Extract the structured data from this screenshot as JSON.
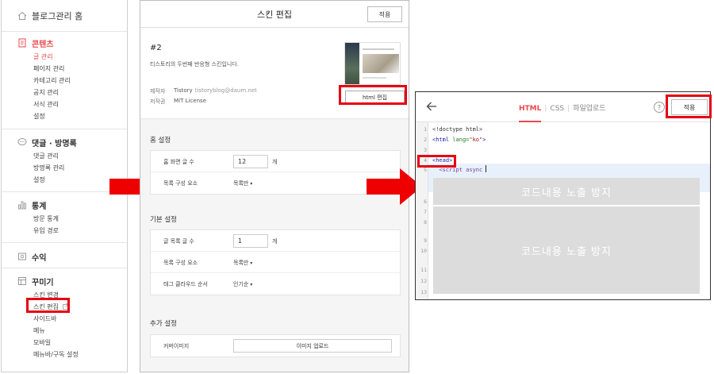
{
  "sidebar": {
    "home": "블로그관리 홈",
    "sections": [
      {
        "title": "콘텐츠",
        "icon": "document-icon",
        "items": [
          "글 관리",
          "페이지 관리",
          "카테고리 관리",
          "공지 관리",
          "서식 관리",
          "설정"
        ]
      },
      {
        "title": "댓글 · 방명록",
        "icon": "speech-bubble-icon",
        "items": [
          "댓글 관리",
          "방명록 관리",
          "설정"
        ]
      },
      {
        "title": "통계",
        "icon": "bar-chart-icon",
        "items": [
          "방문 통계",
          "유입 경로"
        ]
      },
      {
        "title": "수익",
        "icon": "revenue-icon",
        "items": []
      },
      {
        "title": "꾸미기",
        "icon": "decorate-icon",
        "items": [
          "스킨 변경",
          "스킨 편집",
          "사이드바",
          "메뉴",
          "모바일",
          "메뉴바/구독 설정"
        ]
      }
    ]
  },
  "skin_editor": {
    "title": "스킨 편집",
    "apply_label": "적용",
    "skin_number": "#2",
    "description": "티스토리의 두번째 반응형 스킨입니다.",
    "author_label": "제작자",
    "author_name": "Tistory",
    "author_email": "tistoryblog@daum.net",
    "license_label": "저작권",
    "license_value": "MIT License",
    "html_edit_label": "html 편집",
    "home_settings": {
      "title": "홈 설정",
      "rows": [
        {
          "label": "홈 화면 글 수",
          "value": "12",
          "unit": "개"
        },
        {
          "label": "목록 구성 요소",
          "select": "목록만"
        }
      ]
    },
    "basic_settings": {
      "title": "기본 설정",
      "rows": [
        {
          "label": "글 목록 글 수",
          "value": "1",
          "unit": "개"
        },
        {
          "label": "목록 구성 요소",
          "select": "목록만"
        },
        {
          "label": "태그 클라우드 순서",
          "select": "인기순"
        }
      ]
    },
    "extra_settings": {
      "title": "추가 설정",
      "rows": [
        {
          "label": "커버이미지",
          "button": "이미지 업로드"
        }
      ]
    }
  },
  "code_editor": {
    "tabs": [
      "HTML",
      "CSS",
      "파일업로드"
    ],
    "active_tab": "HTML",
    "help_label": "?",
    "apply_label": "적용",
    "lines": {
      "l1": "<!doctype html>",
      "l2_tag": "<html ",
      "l2_attr": "lang=",
      "l2_val": "\"ko\"",
      "l2_close": ">",
      "l4": "<head>",
      "l5": "  <script async"
    },
    "line_numbers": [
      "1",
      "2",
      "3",
      "4",
      "5",
      "6",
      "7",
      "8",
      "9",
      "10",
      "11",
      "12",
      "13"
    ],
    "mask_text": "코드내용 노출 방지"
  },
  "colors": {
    "highlight_red": "#e60012",
    "tistory_red": "#e8494b"
  }
}
